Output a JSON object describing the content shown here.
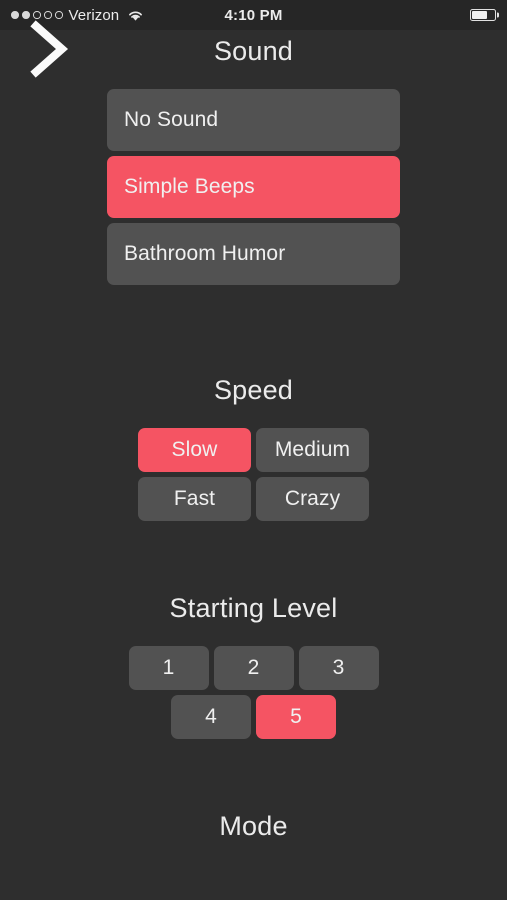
{
  "status_bar": {
    "signal_dots_total": 5,
    "signal_dots_filled": 2,
    "carrier": "Verizon",
    "wifi_icon": "wifi-icon",
    "time": "4:10 PM",
    "battery_icon": "battery-icon",
    "battery_level_percent": 70
  },
  "nav": {
    "back_icon": "chevron-right-icon"
  },
  "colors": {
    "background": "#2e2e2e",
    "status_bar_background": "#262626",
    "button": "#525252",
    "accent_selected": "#f55463",
    "text": "#f0f0f0"
  },
  "sections": {
    "sound": {
      "title": "Sound",
      "options": [
        {
          "label": "No Sound",
          "selected": false
        },
        {
          "label": "Simple Beeps",
          "selected": true
        },
        {
          "label": "Bathroom Humor",
          "selected": false
        }
      ]
    },
    "speed": {
      "title": "Speed",
      "options": [
        {
          "label": "Slow",
          "selected": true
        },
        {
          "label": "Medium",
          "selected": false
        },
        {
          "label": "Fast",
          "selected": false
        },
        {
          "label": "Crazy",
          "selected": false
        }
      ]
    },
    "starting_level": {
      "title": "Starting Level",
      "options": [
        {
          "label": "1",
          "selected": false
        },
        {
          "label": "2",
          "selected": false
        },
        {
          "label": "3",
          "selected": false
        },
        {
          "label": "4",
          "selected": false
        },
        {
          "label": "5",
          "selected": true
        }
      ]
    },
    "mode": {
      "title": "Mode"
    }
  }
}
